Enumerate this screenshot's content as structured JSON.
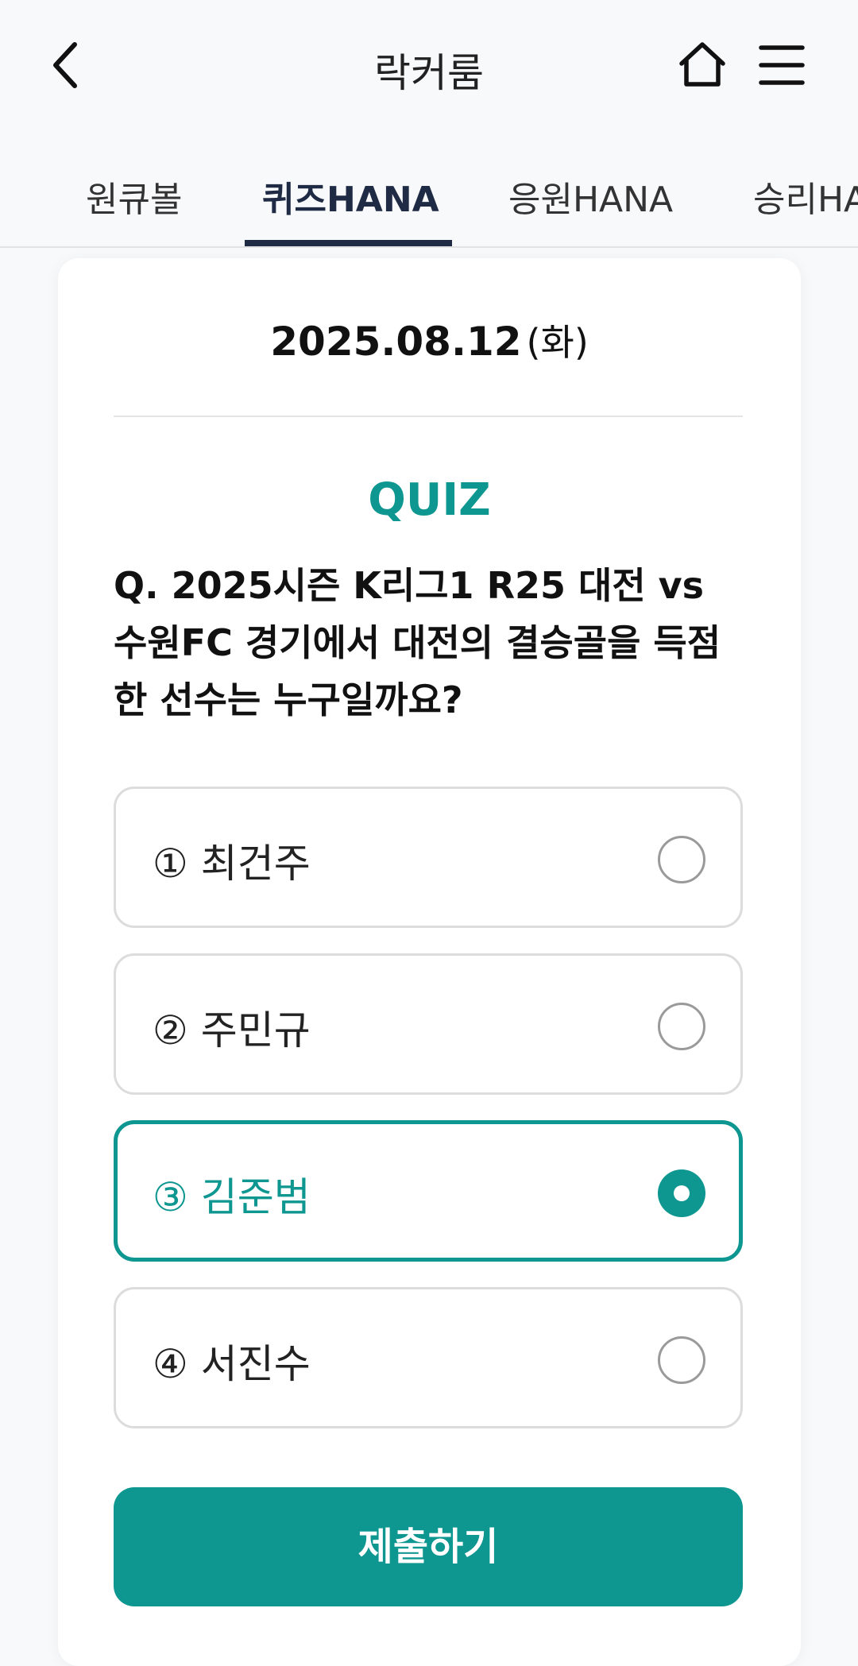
{
  "header": {
    "title": "락커룸",
    "back_icon": "chevron-left-icon",
    "home_icon": "home-icon",
    "menu_icon": "hamburger-menu-icon"
  },
  "tabs": [
    {
      "label": "원큐볼",
      "active": false
    },
    {
      "label": "퀴즈HANA",
      "active": true
    },
    {
      "label": "응원HANA",
      "active": false
    },
    {
      "label": "승리HA",
      "active": false
    }
  ],
  "quiz": {
    "date": "2025.08.12",
    "weekday": "(화)",
    "label": "QUIZ",
    "question": "Q. 2025시즌 K리그1 R25 대전 vs 수원FC 경기에서 대전의 결승골을 득점한 선수는 누구일까요?",
    "options": [
      {
        "label": "① 최건주",
        "selected": false
      },
      {
        "label": "② 주민규",
        "selected": false
      },
      {
        "label": "③ 김준범",
        "selected": true
      },
      {
        "label": "④ 서진수",
        "selected": false
      }
    ],
    "submit_label": "제출하기"
  },
  "colors": {
    "accent": "#0e9691",
    "tab_active": "#1f2a44",
    "background": "#f8f9fa"
  }
}
